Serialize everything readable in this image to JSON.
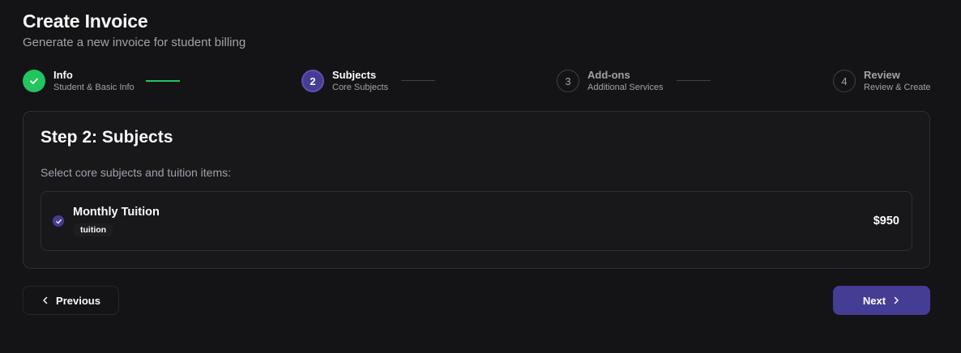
{
  "header": {
    "title": "Create Invoice",
    "subtitle": "Generate a new invoice for student billing"
  },
  "stepper": {
    "steps": [
      {
        "number": "1",
        "label": "Info",
        "sublabel": "Student & Basic Info",
        "status": "complete"
      },
      {
        "number": "2",
        "label": "Subjects",
        "sublabel": "Core Subjects",
        "status": "active"
      },
      {
        "number": "3",
        "label": "Add-ons",
        "sublabel": "Additional Services",
        "status": "upcoming"
      },
      {
        "number": "4",
        "label": "Review",
        "sublabel": "Review & Create",
        "status": "upcoming"
      }
    ]
  },
  "card": {
    "title": "Step 2: Subjects",
    "description": "Select core subjects and tuition items:",
    "items": [
      {
        "name": "Monthly Tuition",
        "tag": "tuition",
        "price": "$950",
        "selected": true
      }
    ]
  },
  "actions": {
    "previous_label": "Previous",
    "next_label": "Next"
  },
  "colors": {
    "background": "#141416",
    "accent": "#453c94",
    "success": "#22c55e",
    "border": "#2e2e33",
    "muted_text": "#a1a1aa"
  },
  "icons": {
    "step1": "check-icon",
    "item": "check-circle-icon",
    "prev": "chevron-left-icon",
    "next": "chevron-right-icon"
  }
}
